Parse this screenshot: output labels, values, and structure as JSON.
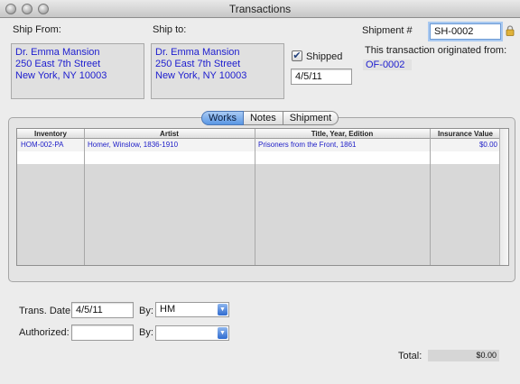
{
  "window": {
    "title": "Transactions"
  },
  "ship_from": {
    "label": "Ship From:",
    "lines": [
      "Dr. Emma Mansion",
      "250 East 7th Street",
      "New York, NY 10003"
    ]
  },
  "ship_to": {
    "label": "Ship to:",
    "lines": [
      "Dr. Emma Mansion",
      "250 East 7th Street",
      "New York, NY 10003"
    ]
  },
  "shipped": {
    "label": "Shipped",
    "checked": true,
    "date": "4/5/11"
  },
  "shipment": {
    "label": "Shipment #",
    "value": "SH-0002",
    "origin_label": "This transaction originated from:",
    "origin_value": "OF-0002"
  },
  "tabs": [
    {
      "label": "Works",
      "active": true
    },
    {
      "label": "Notes",
      "active": false
    },
    {
      "label": "Shipment",
      "active": false
    }
  ],
  "table": {
    "columns": [
      "Inventory",
      "Artist",
      "Title, Year, Edition",
      "Insurance Value"
    ],
    "rows": [
      {
        "inventory": "HOM-002-PA",
        "artist": "Homer, Winslow, 1836-1910",
        "title": "Prisoners from the Front, 1861",
        "value": "$0.00"
      }
    ]
  },
  "footer": {
    "trans_date_label": "Trans. Date:",
    "trans_date": "4/5/11",
    "by_label": "By:",
    "by_value": "HM",
    "authorized_label": "Authorized:",
    "authorized_value": "",
    "by2_label": "By:",
    "by2_value": "",
    "total_label": "Total:",
    "total_value": "$0.00"
  },
  "icons": {
    "lock": "lock-icon",
    "checkmark": "checkmark-icon",
    "dropdown": "chevron-down-icon"
  }
}
